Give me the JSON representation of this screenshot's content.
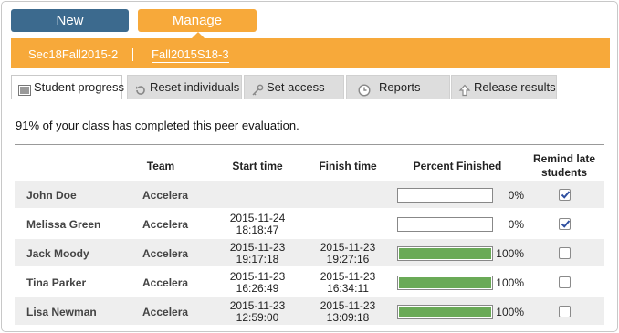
{
  "nav": {
    "new_label": "New",
    "manage_label": "Manage"
  },
  "courses": [
    "Sec18Fall2015-2",
    "Fall2015S18-3"
  ],
  "subtabs": [
    {
      "label": "Student progress",
      "icon": "progress-icon",
      "active": true
    },
    {
      "label": "Reset individuals",
      "icon": "reset-icon",
      "active": false
    },
    {
      "label": "Set access",
      "icon": "key-icon",
      "active": false
    },
    {
      "label": "Reports",
      "icon": "clock-icon",
      "active": false
    },
    {
      "label": "Release results",
      "icon": "upload-arrow-icon",
      "active": false
    }
  ],
  "summary": "91% of your class has completed this peer evaluation.",
  "table": {
    "headers": {
      "team": "Team",
      "start": "Start time",
      "finish": "Finish time",
      "percent": "Percent Finished",
      "remind": "Remind late students"
    },
    "rows": [
      {
        "name": "John Doe",
        "team": "Accelera",
        "start_date": "",
        "start_time": "",
        "finish_date": "",
        "finish_time": "",
        "percent": 0,
        "percent_label": "0%",
        "remind": true
      },
      {
        "name": "Melissa Green",
        "team": "Accelera",
        "start_date": "2015-11-24",
        "start_time": "18:18:47",
        "finish_date": "",
        "finish_time": "",
        "percent": 0,
        "percent_label": "0%",
        "remind": true
      },
      {
        "name": "Jack Moody",
        "team": "Accelera",
        "start_date": "2015-11-23",
        "start_time": "19:17:18",
        "finish_date": "2015-11-23",
        "finish_time": "19:27:16",
        "percent": 100,
        "percent_label": "100%",
        "remind": false
      },
      {
        "name": "Tina Parker",
        "team": "Accelera",
        "start_date": "2015-11-23",
        "start_time": "16:26:49",
        "finish_date": "2015-11-23",
        "finish_time": "16:34:11",
        "percent": 100,
        "percent_label": "100%",
        "remind": false
      },
      {
        "name": "Lisa Newman",
        "team": "Accelera",
        "start_date": "2015-11-23",
        "start_time": "12:59:00",
        "finish_date": "2015-11-23",
        "finish_time": "13:09:18",
        "percent": 100,
        "percent_label": "100%",
        "remind": false
      }
    ]
  },
  "colors": {
    "new_button": "#3c6a8e",
    "accent_orange": "#f7a93a",
    "progress_fill": "#6aaa57"
  }
}
